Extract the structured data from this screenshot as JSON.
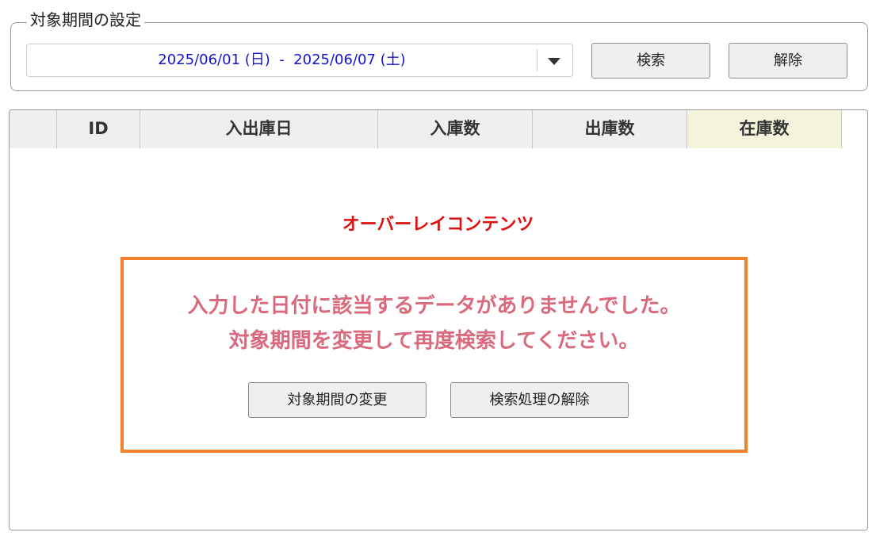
{
  "period": {
    "legend": "対象期間の設定",
    "range_text": "2025/06/01 (日)  -  2025/06/07 (土)",
    "dropdown_icon": "chevron-down-icon",
    "search_label": "検索",
    "clear_label": "解除"
  },
  "table": {
    "columns": [
      "",
      "ID",
      "入出庫日",
      "入庫数",
      "出庫数",
      "在庫数"
    ]
  },
  "overlay": {
    "label": "オーバーレイコンテンツ",
    "message_line1": "入力した日付に該当するデータがありませんでした。",
    "message_line2": "対象期間を変更して再度検索してください。",
    "change_period_label": "対象期間の変更",
    "release_search_label": "検索処理の解除"
  },
  "colors": {
    "date_text": "#1414d2",
    "overlay_label": "#dd1111",
    "overlay_message": "#d96a7e",
    "overlay_border": "#f5822a",
    "stock_header_bg": "#f4f4dc"
  }
}
